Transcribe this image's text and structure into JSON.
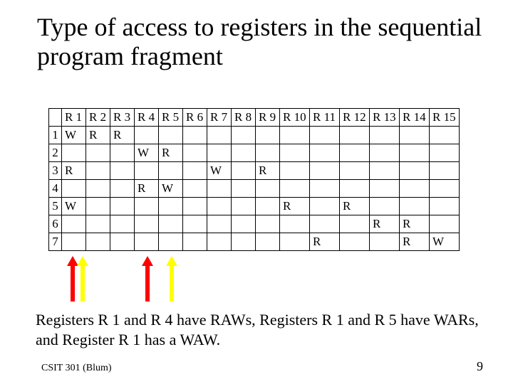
{
  "title": "Type of access to registers in the sequential program fragment",
  "columns": [
    "R 1",
    "R 2",
    "R 3",
    "R 4",
    "R 5",
    "R 6",
    "R 7",
    "R 8",
    "R 9",
    "R 10",
    "R 11",
    "R 12",
    "R 13",
    "R 14",
    "R 15"
  ],
  "rows": [
    {
      "n": "1",
      "cells": [
        "W",
        "R",
        "R",
        "",
        "",
        "",
        "",
        "",
        "",
        "",
        "",
        "",
        "",
        "",
        ""
      ]
    },
    {
      "n": "2",
      "cells": [
        "",
        "",
        "",
        "W",
        "R",
        "",
        "",
        "",
        "",
        "",
        "",
        "",
        "",
        "",
        ""
      ]
    },
    {
      "n": "3",
      "cells": [
        "R",
        "",
        "",
        "",
        "",
        "",
        "W",
        "",
        "R",
        "",
        "",
        "",
        "",
        "",
        ""
      ]
    },
    {
      "n": "4",
      "cells": [
        "",
        "",
        "",
        "R",
        "W",
        "",
        "",
        "",
        "",
        "",
        "",
        "",
        "",
        "",
        ""
      ]
    },
    {
      "n": "5",
      "cells": [
        "W",
        "",
        "",
        "",
        "",
        "",
        "",
        "",
        "",
        "R",
        "",
        "R",
        "",
        "",
        ""
      ]
    },
    {
      "n": "6",
      "cells": [
        "",
        "",
        "",
        "",
        "",
        "",
        "",
        "",
        "",
        "",
        "",
        "",
        "R",
        "R",
        ""
      ]
    },
    {
      "n": "7",
      "cells": [
        "",
        "",
        "",
        "",
        "",
        "",
        "",
        "",
        "",
        "",
        "R",
        "",
        "",
        "R",
        "W"
      ]
    }
  ],
  "caption": "Registers R 1 and R 4 have RAWs, Registers R 1 and R 5 have WARs, and Register R 1 has a WAW.",
  "footer_left": "CSIT 301 (Blum)",
  "footer_right": "9",
  "chart_data": {
    "type": "table",
    "title": "Register access types by instruction",
    "columns": [
      "R1",
      "R2",
      "R3",
      "R4",
      "R5",
      "R6",
      "R7",
      "R8",
      "R9",
      "R10",
      "R11",
      "R12",
      "R13",
      "R14",
      "R15"
    ],
    "rows": {
      "1": {
        "R1": "W",
        "R2": "R",
        "R3": "R"
      },
      "2": {
        "R4": "W",
        "R5": "R"
      },
      "3": {
        "R1": "R",
        "R7": "W",
        "R9": "R"
      },
      "4": {
        "R4": "R",
        "R5": "W"
      },
      "5": {
        "R1": "W",
        "R10": "R",
        "R12": "R"
      },
      "6": {
        "R13": "R",
        "R14": "R"
      },
      "7": {
        "R11": "R",
        "R14": "R",
        "R15": "W"
      }
    },
    "hazards": {
      "RAW": [
        "R1",
        "R4"
      ],
      "WAR": [
        "R1",
        "R5"
      ],
      "WAW": [
        "R1"
      ]
    }
  }
}
